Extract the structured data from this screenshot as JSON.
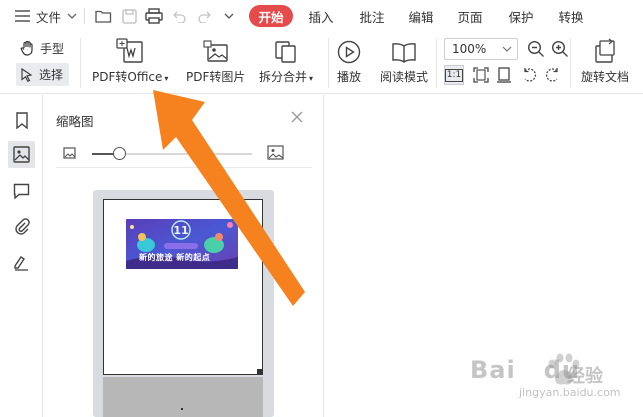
{
  "menubar": {
    "file_label": "文件",
    "tabs": [
      "开始",
      "插入",
      "批注",
      "编辑",
      "页面",
      "保护",
      "转换"
    ],
    "active_tab_color": "#e64b4b"
  },
  "ribbon": {
    "hand_label": "手型",
    "select_label": "选择",
    "pdf_to_office_label": "PDF转Office",
    "pdf_to_image_label": "PDF转图片",
    "split_merge_label": "拆分合并",
    "play_label": "播放",
    "read_mode_label": "阅读模式",
    "zoom_value": "100%",
    "actual_size_label": "1:1",
    "rotate_doc_label": "旋转文档"
  },
  "thumbnail_panel": {
    "title": "缩略图",
    "thumbnail_size_fraction": 0.17,
    "banner_text": "新的旅途 新的起点"
  },
  "annotation": {
    "arrow_color": "#f5821f"
  },
  "watermark": {
    "brand": "Bai",
    "brand_suffix": "du",
    "cn": "经验",
    "url": "jingyan.baidu.com"
  }
}
